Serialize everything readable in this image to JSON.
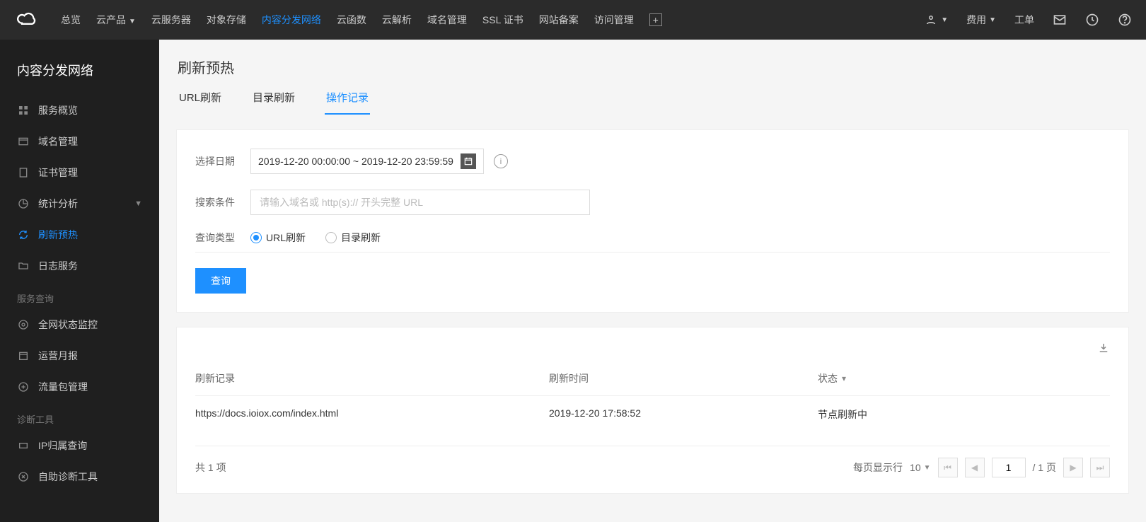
{
  "topnav": {
    "overview": "总览",
    "products": "云产品",
    "items": [
      "云服务器",
      "对象存储",
      "内容分发网络",
      "云函数",
      "云解析",
      "域名管理",
      "SSL 证书",
      "网站备案",
      "访问管理"
    ],
    "active_index": 2
  },
  "top_right": {
    "fee": "费用",
    "ticket": "工单"
  },
  "sidebar": {
    "title": "内容分发网络",
    "items": [
      {
        "label": "服务概览",
        "active": false
      },
      {
        "label": "域名管理",
        "active": false
      },
      {
        "label": "证书管理",
        "active": false
      },
      {
        "label": "统计分析",
        "active": false,
        "expandable": true
      },
      {
        "label": "刷新预热",
        "active": true
      },
      {
        "label": "日志服务",
        "active": false
      }
    ],
    "section_query": "服务查询",
    "query_items": [
      "全网状态监控",
      "运营月报",
      "流量包管理"
    ],
    "section_diag": "诊断工具",
    "diag_items": [
      "IP归属查询",
      "自助诊断工具"
    ]
  },
  "page": {
    "title": "刷新预热"
  },
  "tabs": {
    "items": [
      "URL刷新",
      "目录刷新",
      "操作记录"
    ],
    "active": 2
  },
  "filter": {
    "date_label": "选择日期",
    "date_value": "2019-12-20 00:00:00 ~ 2019-12-20 23:59:59",
    "search_label": "搜索条件",
    "search_placeholder": "请输入域名或 http(s):// 开头完整 URL",
    "type_label": "查询类型",
    "radio1": "URL刷新",
    "radio2": "目录刷新",
    "query_btn": "查询"
  },
  "table": {
    "headers": [
      "刷新记录",
      "刷新时间",
      "状态"
    ],
    "rows": [
      {
        "record": "https://docs.ioiox.com/index.html",
        "time": "2019-12-20 17:58:52",
        "status": "节点刷新中"
      }
    ]
  },
  "pager": {
    "total_prefix": "共",
    "total_count": "1",
    "total_suffix": "项",
    "per_page_label": "每页显示行",
    "per_page": "10",
    "current": "1",
    "total_pages": "/ 1 页"
  }
}
